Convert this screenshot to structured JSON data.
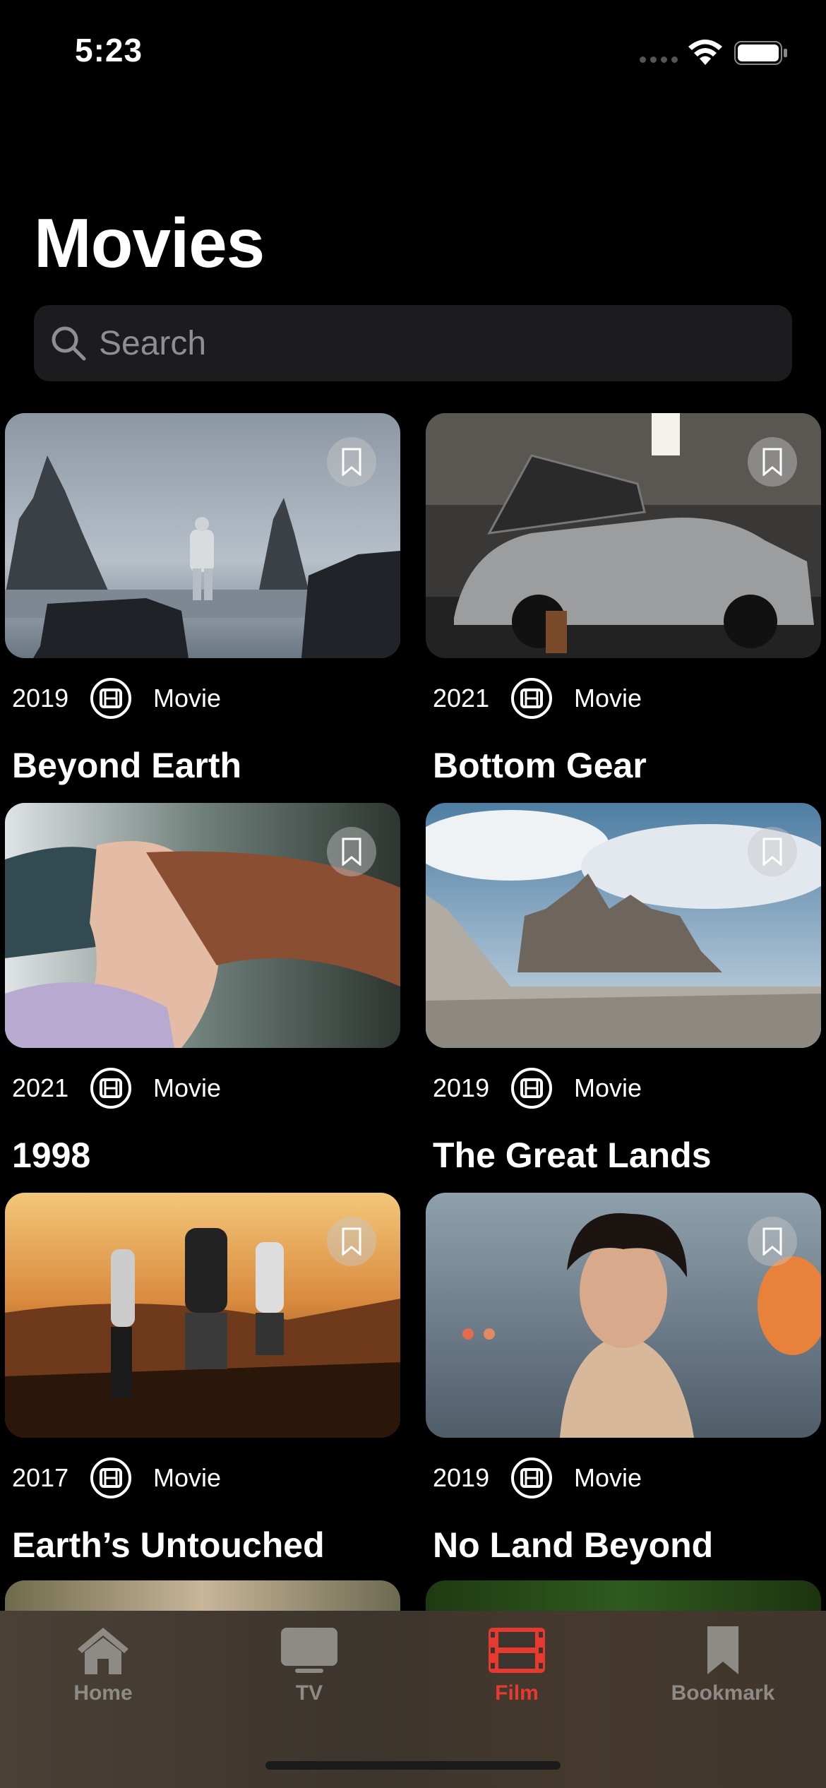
{
  "status_bar": {
    "time": "5:23"
  },
  "page": {
    "title": "Movies"
  },
  "search": {
    "placeholder": "Search"
  },
  "movies": [
    {
      "year": "2019",
      "type": "Movie",
      "title": "Beyond Earth"
    },
    {
      "year": "2021",
      "type": "Movie",
      "title": "Bottom Gear"
    },
    {
      "year": "2021",
      "type": "Movie",
      "title": "1998"
    },
    {
      "year": "2019",
      "type": "Movie",
      "title": "The Great Lands"
    },
    {
      "year": "2017",
      "type": "Movie",
      "title": "Earth’s Untouched"
    },
    {
      "year": "2019",
      "type": "Movie",
      "title": "No Land Beyond"
    }
  ],
  "tab_bar": {
    "tabs": [
      {
        "label": "Home",
        "icon": "home-icon"
      },
      {
        "label": "TV",
        "icon": "tv-icon"
      },
      {
        "label": "Film",
        "icon": "film-icon",
        "active": true
      },
      {
        "label": "Bookmark",
        "icon": "bookmark-icon"
      }
    ],
    "active_color": "#e63a30"
  }
}
